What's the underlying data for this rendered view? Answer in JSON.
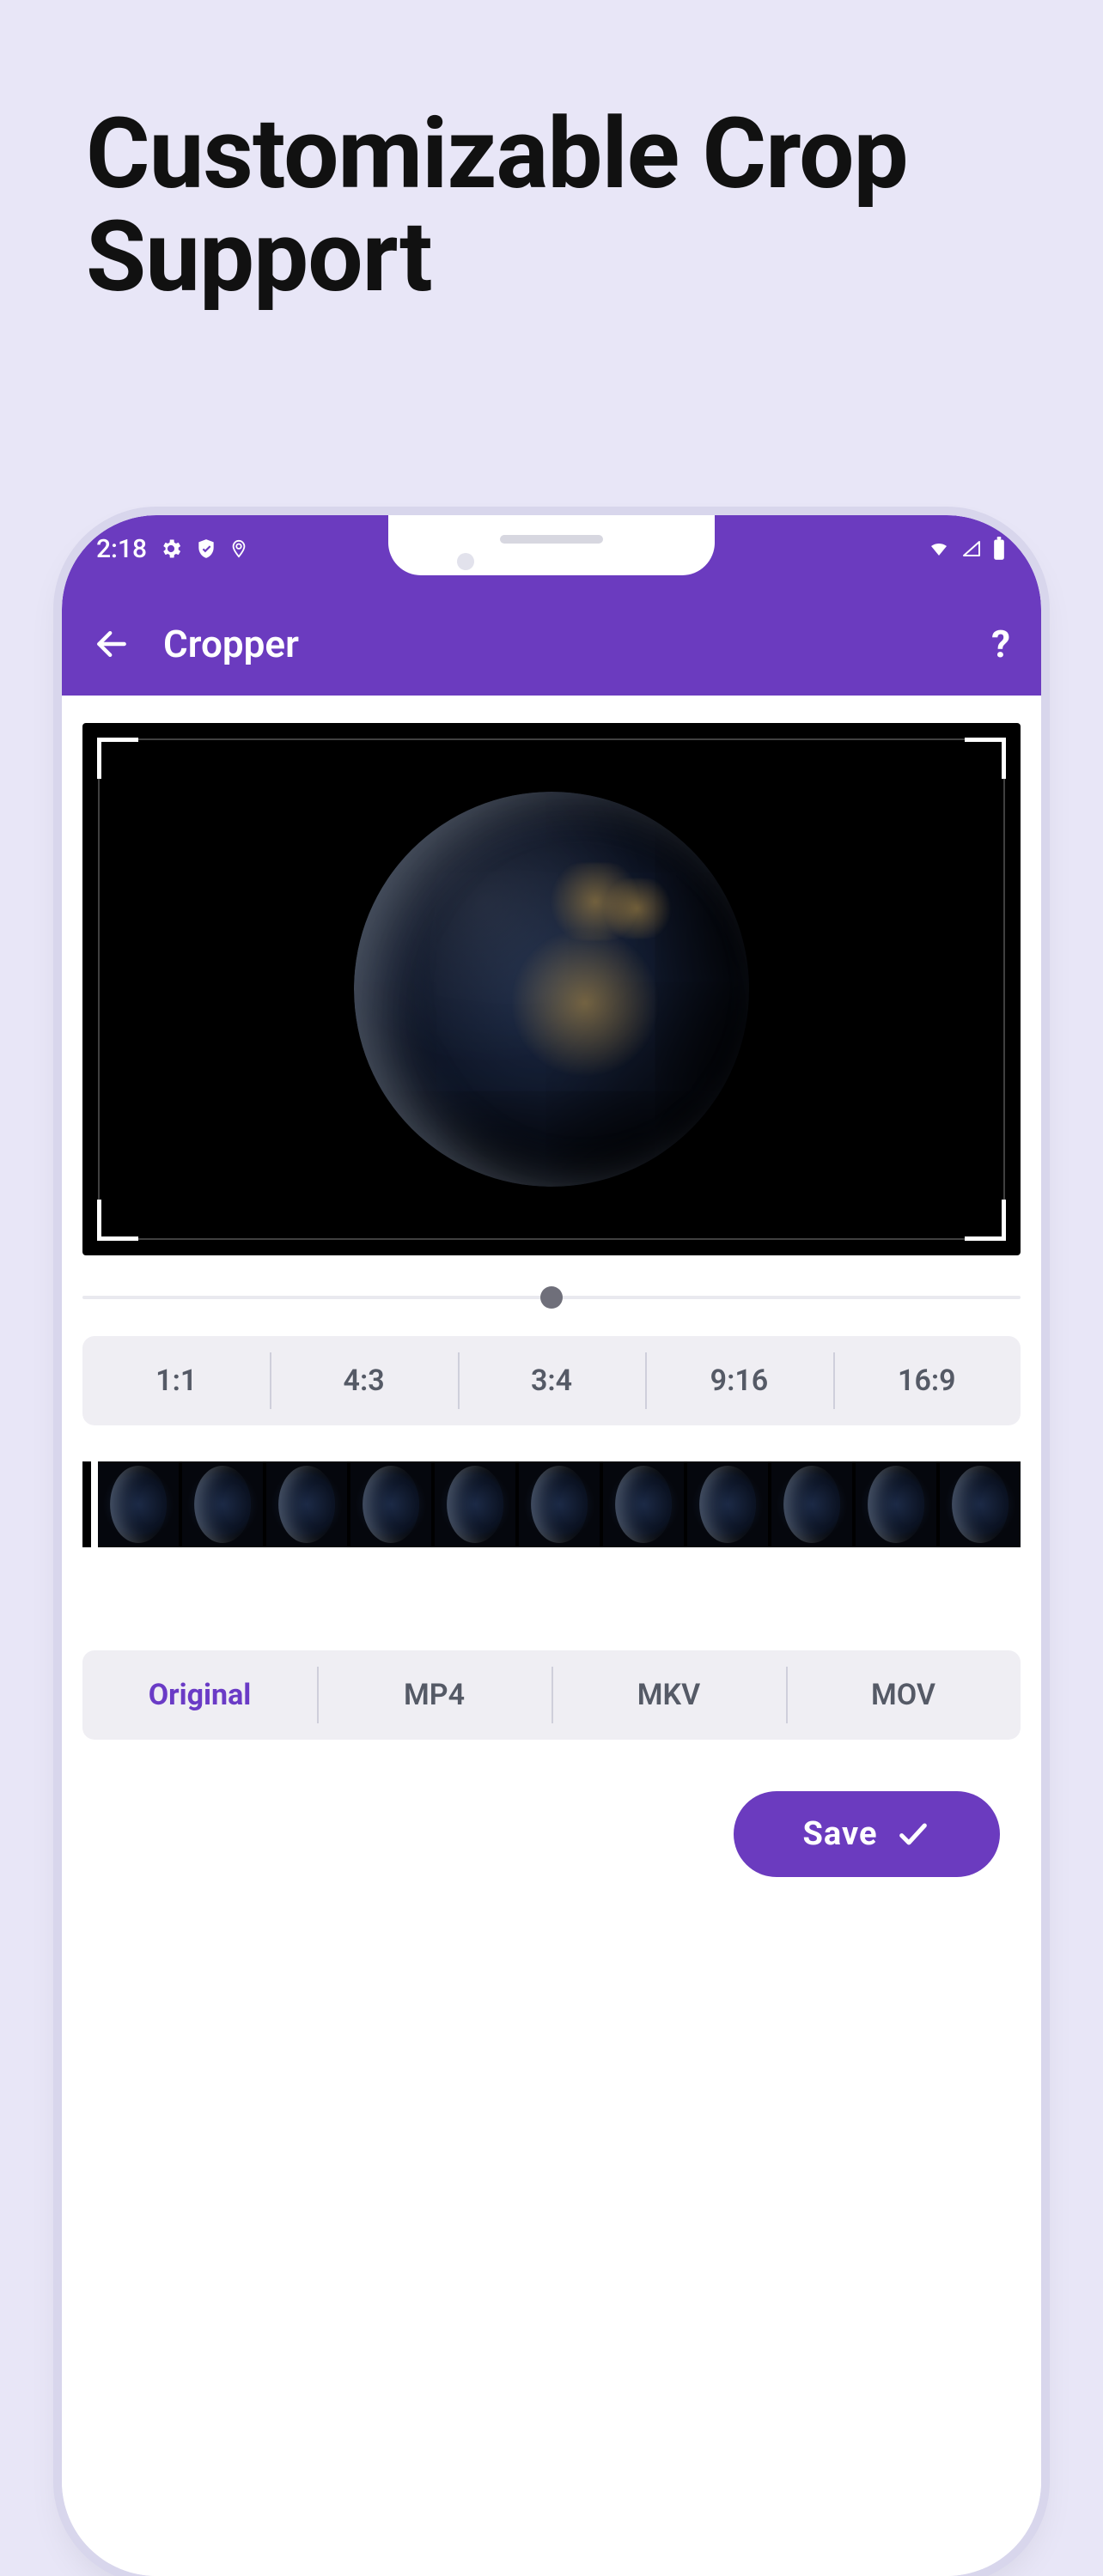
{
  "marketing": {
    "headline": "Customizable Crop Support"
  },
  "status": {
    "time": "2:18",
    "icons_left": [
      "settings-icon",
      "shield-icon",
      "location-icon"
    ],
    "icons_right": [
      "wifi-icon",
      "signal-icon",
      "battery-icon"
    ]
  },
  "appbar": {
    "back_icon": "back-arrow-icon",
    "title": "Cropper",
    "help_icon": "help-icon",
    "help_glyph": "?"
  },
  "preview": {
    "subject": "earth-night-globe"
  },
  "slider": {
    "value_pct": 50
  },
  "ratios": {
    "options": [
      "1:1",
      "4:3",
      "3:4",
      "9:16",
      "16:9"
    ],
    "selected_index": -1
  },
  "timeline": {
    "frame_count": 11
  },
  "formats": {
    "options": [
      "Original",
      "MP4",
      "MKV",
      "MOV"
    ],
    "selected_index": 0
  },
  "save": {
    "label": "Save",
    "icon": "check-icon"
  },
  "colors": {
    "accent": "#6b3bbf",
    "bg": "#e8e6f7"
  }
}
